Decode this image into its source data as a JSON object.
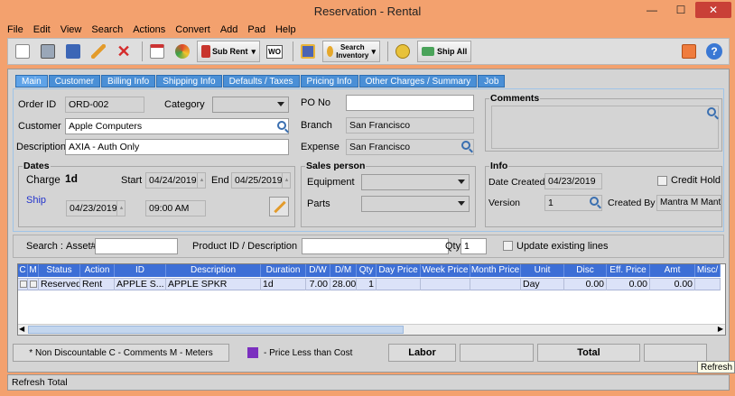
{
  "window": {
    "title": "Reservation - Rental",
    "min": "—",
    "max": "☐",
    "close": "✕"
  },
  "menu": [
    "File",
    "Edit",
    "View",
    "Search",
    "Actions",
    "Convert",
    "Add",
    "Pad",
    "Help"
  ],
  "toolbar": {
    "sub_rent": "Sub Rent",
    "wo": "WO",
    "search_inventory": "Search Inventory",
    "ship_all": "Ship All"
  },
  "tabs": [
    "Main",
    "Customer",
    "Billing Info",
    "Shipping Info",
    "Defaults / Taxes",
    "Pricing Info",
    "Other Charges / Summary",
    "Job"
  ],
  "form": {
    "order_id_label": "Order ID",
    "order_id": "ORD-002",
    "category_label": "Category",
    "category": "",
    "po_label": "PO No",
    "po": "",
    "customer_label": "Customer",
    "customer": "Apple Computers",
    "branch_label": "Branch",
    "branch": "San Francisco",
    "description_label": "Description",
    "description": "AXIA - Auth Only",
    "expense_label": "Expense",
    "expense": "San Francisco",
    "comments_label": "Comments",
    "comments": "",
    "dates_label": "Dates",
    "charge_label": "Charge",
    "charge": "1d",
    "start_label": "Start",
    "start": "04/24/2019",
    "end_label": "End",
    "end": "04/25/2019",
    "ship_label": "Ship",
    "ship_date": "04/23/2019",
    "ship_time": "09:00 AM",
    "salesperson_label": "Sales person",
    "equipment_label": "Equipment",
    "equipment": "",
    "parts_label": "Parts",
    "parts": "",
    "info_label": "Info",
    "date_created_label": "Date Created",
    "date_created": "04/23/2019",
    "credit_hold_label": "Credit Hold",
    "version_label": "Version",
    "version": "1",
    "created_by_label": "Created By",
    "created_by": "Mantra M Mantra"
  },
  "search": {
    "label": "Search :",
    "asset_label": "Asset#",
    "asset": "",
    "product_label": "Product ID / Description",
    "product": "",
    "qty_label": "Qty",
    "qty": "1",
    "update_label": "Update existing lines"
  },
  "grid": {
    "headers": [
      "C",
      "M",
      "Status",
      "Action",
      "ID",
      "Description",
      "Duration",
      "D/W",
      "D/M",
      "Qty",
      "Day Price",
      "Week Price",
      "Month Price",
      "Unit",
      "Disc",
      "Eff. Price",
      "Amt",
      "Misc/"
    ],
    "rows": [
      [
        "",
        "",
        "Reserved",
        "Rent",
        "APPLE S...",
        "APPLE SPKR",
        "1d",
        "7.00",
        "28.00",
        "1",
        "",
        "",
        "",
        "Day",
        "0.00",
        "0.00",
        "0.00",
        ""
      ]
    ]
  },
  "bottom": {
    "legend": "* Non Discountable  C - Comments  M - Meters",
    "price_less": "- Price Less than Cost",
    "labor": "Labor",
    "total": "Total",
    "price_less_color": "#7b2fbf"
  },
  "status": {
    "text": "Refresh Total",
    "tooltip": "Refresh Total"
  }
}
